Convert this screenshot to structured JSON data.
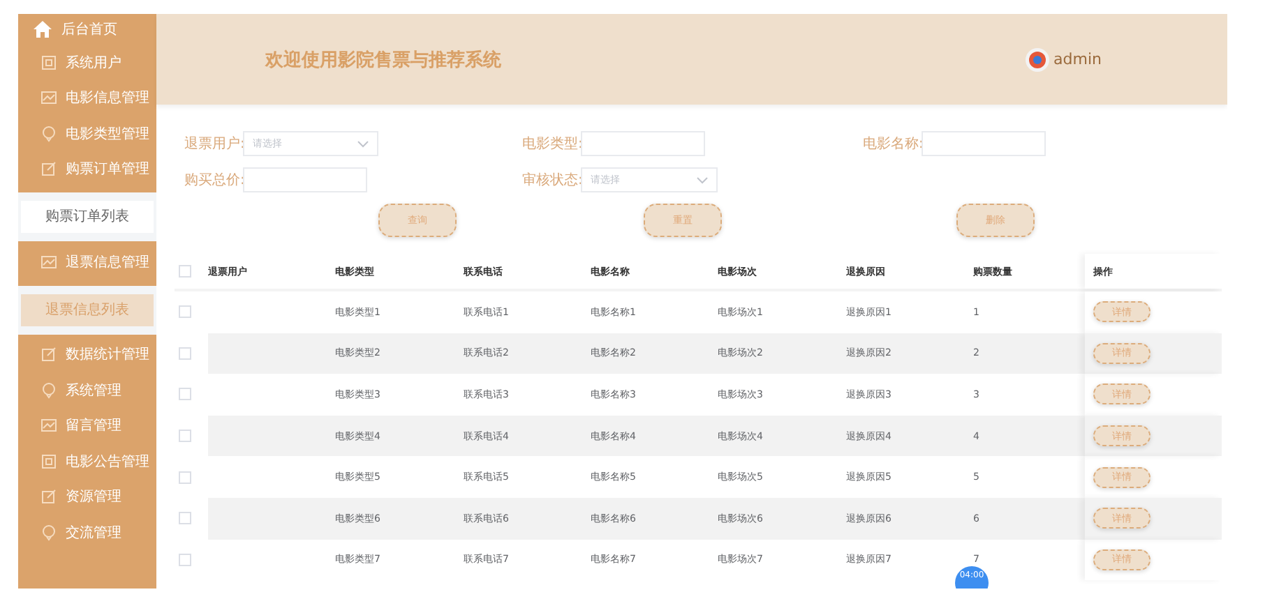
{
  "sidebar": {
    "home": "后台首页",
    "items": [
      {
        "kind": "menu",
        "label": "系统用户"
      },
      {
        "kind": "menu",
        "label": "电影信息管理"
      },
      {
        "kind": "menu",
        "label": "电影类型管理"
      },
      {
        "kind": "menu",
        "label": "购票订单管理"
      },
      {
        "kind": "submenu",
        "label": "购票订单列表",
        "selected": false
      },
      {
        "kind": "menu",
        "label": "退票信息管理"
      },
      {
        "kind": "submenu",
        "label": "退票信息列表",
        "selected": true
      },
      {
        "kind": "menu",
        "label": "数据统计管理"
      },
      {
        "kind": "menu",
        "label": "系统管理"
      },
      {
        "kind": "menu",
        "label": "留言管理"
      },
      {
        "kind": "menu",
        "label": "电影公告管理"
      },
      {
        "kind": "menu",
        "label": "资源管理"
      },
      {
        "kind": "menu",
        "label": "交流管理"
      }
    ]
  },
  "header": {
    "title": "欢迎使用影院售票与推荐系统",
    "user": "admin"
  },
  "filters": [
    {
      "kind": "select",
      "label": "退票用户:",
      "placeholder": "请选择"
    },
    {
      "kind": "input",
      "label": "电影类型:"
    },
    {
      "kind": "input",
      "label": "电影名称:"
    },
    {
      "kind": "input",
      "label": "购买总价:"
    },
    {
      "kind": "select",
      "label": "审核状态:",
      "placeholder": "请选择"
    }
  ],
  "buttons": [
    "查询",
    "重置",
    "删除"
  ],
  "table": {
    "all_checked": false,
    "columns": [
      "退票用户",
      "电影类型",
      "联系电话",
      "电影名称",
      "电影场次",
      "退换原因",
      "购票数量",
      "操作"
    ],
    "rows": [
      {
        "checked": false,
        "cells": [
          "",
          "电影类型1",
          "联系电话1",
          "电影名称1",
          "电影场次1",
          "退换原因1",
          "1"
        ],
        "action": "详情"
      },
      {
        "checked": false,
        "cells": [
          "",
          "电影类型2",
          "联系电话2",
          "电影名称2",
          "电影场次2",
          "退换原因2",
          "2"
        ],
        "action": "详情"
      },
      {
        "checked": false,
        "cells": [
          "",
          "电影类型3",
          "联系电话3",
          "电影名称3",
          "电影场次3",
          "退换原因3",
          "3"
        ],
        "action": "详情"
      },
      {
        "checked": false,
        "cells": [
          "",
          "电影类型4",
          "联系电话4",
          "电影名称4",
          "电影场次4",
          "退换原因4",
          "4"
        ],
        "action": "详情"
      },
      {
        "checked": false,
        "cells": [
          "",
          "电影类型5",
          "联系电话5",
          "电影名称5",
          "电影场次5",
          "退换原因5",
          "5"
        ],
        "action": "详情"
      },
      {
        "checked": false,
        "cells": [
          "",
          "电影类型6",
          "联系电话6",
          "电影名称6",
          "电影场次6",
          "退换原因6",
          "6"
        ],
        "action": "详情"
      },
      {
        "checked": false,
        "cells": [
          "",
          "电影类型7",
          "联系电话7",
          "电影名称7",
          "电影场次7",
          "退换原因7",
          "7"
        ],
        "action": "详情"
      }
    ]
  },
  "timer": "04:00"
}
